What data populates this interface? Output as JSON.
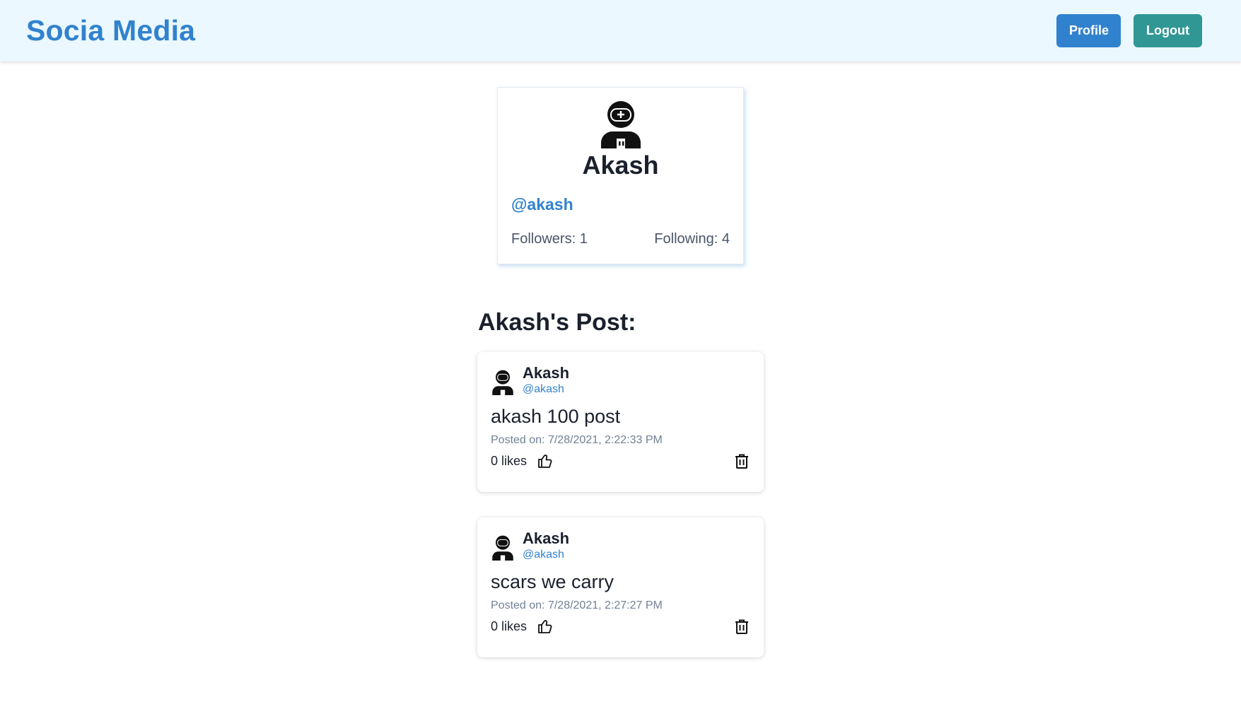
{
  "header": {
    "brand": "Socia Media",
    "profile_label": "Profile",
    "logout_label": "Logout"
  },
  "profile": {
    "avatar_icon": "astronaut-avatar-icon",
    "name": "Akash",
    "handle": "@akash",
    "followers_label": "Followers: 1",
    "following_label": "Following: 4"
  },
  "posts_section": {
    "heading": "Akash's Post:",
    "posts": [
      {
        "author": "Akash",
        "handle": "@akash",
        "content": "akash 100 post",
        "posted_on": "Posted on: 7/28/2021, 2:22:33 PM",
        "likes": "0 likes",
        "like_icon": "thumbs-up-icon",
        "delete_icon": "trash-icon"
      },
      {
        "author": "Akash",
        "handle": "@akash",
        "content": "scars we carry",
        "posted_on": "Posted on: 7/28/2021, 2:27:27 PM",
        "likes": "0 likes",
        "like_icon": "thumbs-up-icon",
        "delete_icon": "trash-icon"
      }
    ]
  },
  "colors": {
    "brand": "#3182ce",
    "header_bg": "#ebf8ff",
    "profile_button": "#3182ce",
    "logout_button": "#319795"
  }
}
